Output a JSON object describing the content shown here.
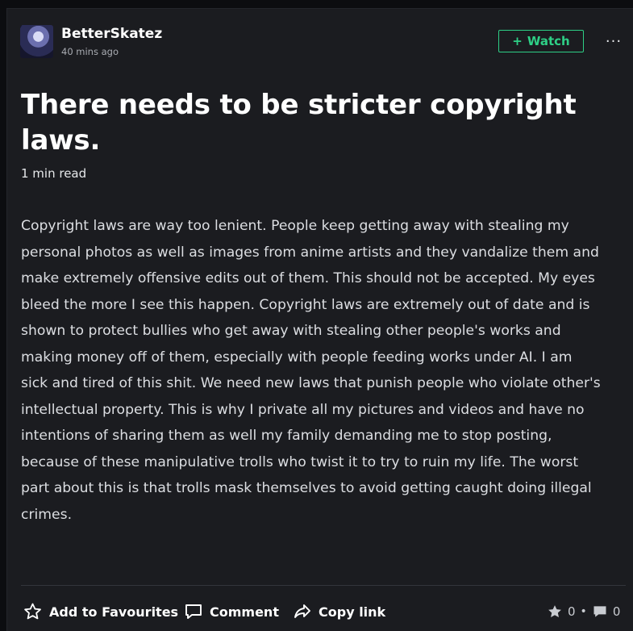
{
  "post": {
    "author": "BetterSkatez",
    "time_ago": "40 mins ago",
    "watch_label": "Watch",
    "more_label": "···",
    "title": "There needs to be stricter copyright laws.",
    "read_time": "1 min read",
    "body": "Copyright laws are way too lenient. People keep getting away with stealing my personal photos as well as images from anime artists and they vandalize them and make extremely offensive edits out of them. This should not be accepted. My eyes bleed the more I see this happen. Copyright laws are extremely out of date and is shown to protect bullies who get away with stealing other people's works and making money off of them, especially with people feeding works under AI. I am sick and tired of this shit. We need new laws that punish people who violate other's intellectual property. This is why I private all my pictures and videos and have no intentions of sharing them as well my family demanding me to stop posting, because of these manipulative trolls who twist it to try to ruin my life. The worst part about this is that trolls mask themselves to avoid getting caught doing illegal crimes."
  },
  "actions": {
    "favourite_label": "Add to Favourites",
    "comment_label": "Comment",
    "copy_link_label": "Copy link"
  },
  "stats": {
    "favourites": "0",
    "separator": "•",
    "comments": "0"
  },
  "icons": {
    "watch": "plus-icon",
    "favourite": "star-outline-icon",
    "comment": "speech-bubble-icon",
    "copy_link": "share-arrow-icon",
    "fav_count": "star-filled-icon",
    "comment_count": "speech-bubble-filled-icon"
  },
  "colors": {
    "accent": "#2ecf86",
    "background": "#1b1c20"
  }
}
